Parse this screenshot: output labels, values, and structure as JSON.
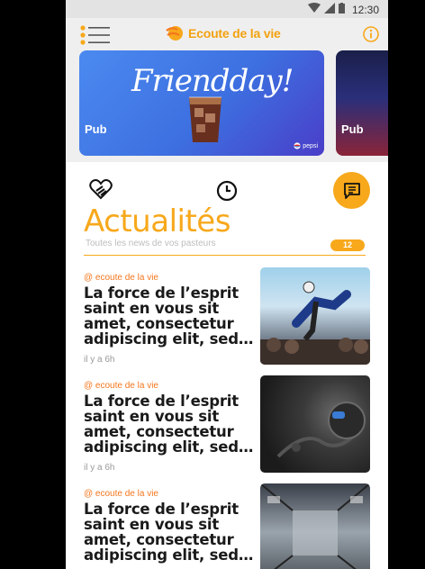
{
  "status_bar": {
    "time": "12:30"
  },
  "app_bar": {
    "title": "Ecoute de la vie"
  },
  "banners": [
    {
      "label": "Pub",
      "headline": "Friendday!",
      "sponsor": "pepsi"
    },
    {
      "label": "Pub"
    }
  ],
  "section": {
    "title": "Actualités",
    "subtitle": "Toutes les news de vos pasteurs",
    "count": "12"
  },
  "news": [
    {
      "source": "@ ecoute de la vie",
      "title": "La force de l’esprit saint en vous sit amet, consectetur adipiscing elit, sed…",
      "time": "il y a 6h"
    },
    {
      "source": "@ ecoute de la vie",
      "title": "La force de l’esprit saint en vous sit amet, consectetur adipiscing elit, sed…",
      "time": "il y a 6h"
    },
    {
      "source": "@ ecoute de la vie",
      "title": "La force de l’esprit saint en vous sit amet, consectetur adipiscing elit, sed…",
      "time": ""
    }
  ],
  "colors": {
    "accent": "#f7a81b",
    "source": "#f5771e",
    "background": "#ffffff"
  },
  "icons": [
    "menu-icon",
    "logo-icon",
    "info-icon",
    "heart-hands-icon",
    "clock-icon",
    "message-icon"
  ]
}
